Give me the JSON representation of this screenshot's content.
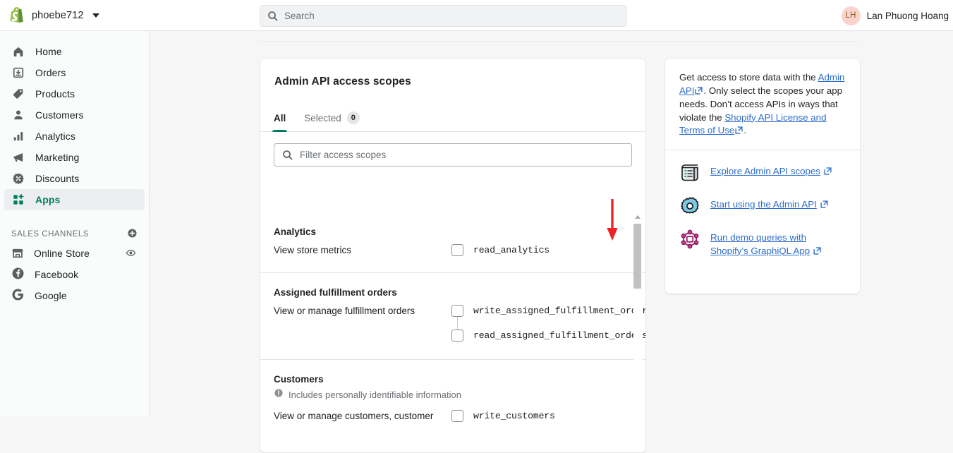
{
  "topbar": {
    "store_name": "phoebe712",
    "store_icon": "shopify-logo-icon",
    "search": {
      "icon": "search-icon",
      "placeholder": "Search",
      "value": ""
    },
    "user": {
      "initials": "LH",
      "name": "Lan Phuong Hoang"
    }
  },
  "sidebar": {
    "items": [
      {
        "label": "Home",
        "icon": "home-icon",
        "active": false
      },
      {
        "label": "Orders",
        "icon": "orders-icon",
        "active": false
      },
      {
        "label": "Products",
        "icon": "tag-icon",
        "active": false
      },
      {
        "label": "Customers",
        "icon": "person-icon",
        "active": false
      },
      {
        "label": "Analytics",
        "icon": "bar-chart-icon",
        "active": false
      },
      {
        "label": "Marketing",
        "icon": "megaphone-icon",
        "active": false
      },
      {
        "label": "Discounts",
        "icon": "discount-icon",
        "active": false
      },
      {
        "label": "Apps",
        "icon": "apps-grid-icon",
        "active": true
      }
    ],
    "section_label": "SALES CHANNELS",
    "section_add_icon": "plus-circle-icon",
    "channels": [
      {
        "label": "Online Store",
        "icon": "store-icon",
        "trailing_icon": "eye-icon"
      },
      {
        "label": "Facebook",
        "icon": "facebook-icon",
        "trailing_icon": ""
      },
      {
        "label": "Google",
        "icon": "google-icon",
        "trailing_icon": ""
      }
    ]
  },
  "card": {
    "title": "Admin API access scopes",
    "tabs": [
      {
        "label": "All",
        "badge": "",
        "active": true
      },
      {
        "label": "Selected",
        "badge": "0",
        "active": false
      }
    ],
    "filter": {
      "icon": "search-icon",
      "placeholder": "Filter access scopes",
      "value": ""
    },
    "scope_groups": [
      {
        "title": "Analytics",
        "pii": "",
        "description": "View store metrics",
        "scopes": [
          {
            "name": "read_analytics",
            "checked": false
          }
        ]
      },
      {
        "title": "Assigned fulfillment orders",
        "pii": "",
        "description": "View or manage fulfillment orders",
        "scopes": [
          {
            "name": "write_assigned_fulfillment_orders",
            "checked": false
          },
          {
            "name": "read_assigned_fulfillment_orders",
            "checked": false
          }
        ]
      },
      {
        "title": "Customers",
        "pii": "Includes personally identifiable information",
        "description": "View or manage customers, customer",
        "scopes": [
          {
            "name": "write_customers",
            "checked": false
          }
        ]
      }
    ],
    "scrollbar": {
      "up_arrow_icon": "scroll-up-arrow-icon"
    }
  },
  "annotation": {
    "arrow_icon": "red-down-arrow-icon",
    "color": "#ee2222"
  },
  "side_panel": {
    "paragraph": {
      "p1": "Get access to store data with the ",
      "link1": "Admin API",
      "p2": ". Only select the scopes your app needs. Don’t access APIs in ways that violate the ",
      "link2": "Shopify API License and Terms of Use",
      "p3": "."
    },
    "links": [
      {
        "label": "Explore Admin API scopes",
        "icon": "scroll-document-icon",
        "external_icon": "external-link-icon"
      },
      {
        "label": "Start using the Admin API",
        "icon": "gear-icon",
        "external_icon": "external-link-icon"
      },
      {
        "label": "Run demo queries with Shopify’s GraphiQL App",
        "icon": "graphiql-molecule-icon",
        "external_icon": "external-link-icon"
      }
    ]
  },
  "colors": {
    "brand_green": "#008060",
    "link_blue": "#2c6ecb",
    "annotation_red": "#ee2222",
    "page_bg": "#f6f6f7"
  }
}
